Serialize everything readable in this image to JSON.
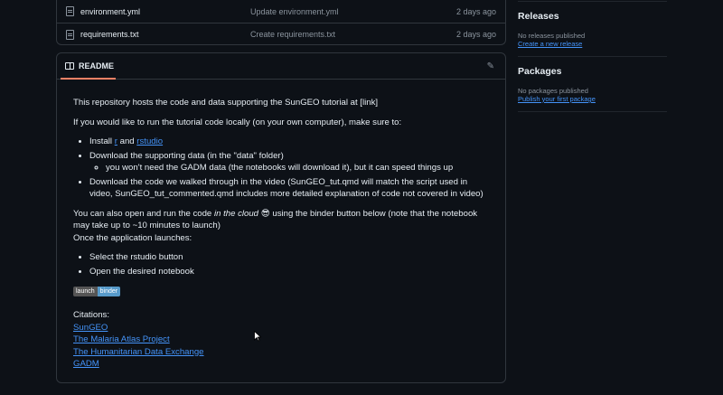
{
  "files": [
    {
      "name": "environment.yml",
      "message": "Update environment.yml",
      "date": "2 days ago"
    },
    {
      "name": "requirements.txt",
      "message": "Create requirements.txt",
      "date": "2 days ago"
    }
  ],
  "readme": {
    "tab_label": "README",
    "intro": "This repository hosts the code and data supporting the SunGEO tutorial at [link]",
    "local_run": "If you would like to run the tutorial code locally (on your own computer), make sure to:",
    "install_prefix": "Install",
    "install_r": "r",
    "install_and": "and",
    "install_rstudio": "rstudio",
    "download_data": "Download the supporting data (in the \"data\" folder)",
    "gadm_note": "you won't need the GADM data (the notebooks will download it), but it can speed things up",
    "download_code": "Download the code we walked through in the video (SunGEO_tut.qmd will match the script used in video, SunGEO_tut_commented.qmd includes more detailed explanation of code not covered in video)",
    "cloud_prefix": "You can also open and run the code",
    "cloud_em": "in the cloud",
    "cloud_emoji": "😎",
    "cloud_suffix": "using the binder button below (note that the notebook may take up to ~10 minutes to launch)",
    "app_launch": "Once the application launches:",
    "steps": [
      "Select the rstudio button",
      "Open the desired notebook"
    ],
    "badge_left": "launch",
    "badge_right": "binder",
    "citations_label": "Citations:",
    "citations": [
      "SunGEO",
      "The Malaria Atlas Project",
      "The Humanitarian Data Exchange",
      "GADM"
    ]
  },
  "sidebar": {
    "releases_title": "Releases",
    "releases_text": "No releases published",
    "releases_link": "Create a new release",
    "packages_title": "Packages",
    "packages_text": "No packages published",
    "packages_link": "Publish your first package"
  }
}
